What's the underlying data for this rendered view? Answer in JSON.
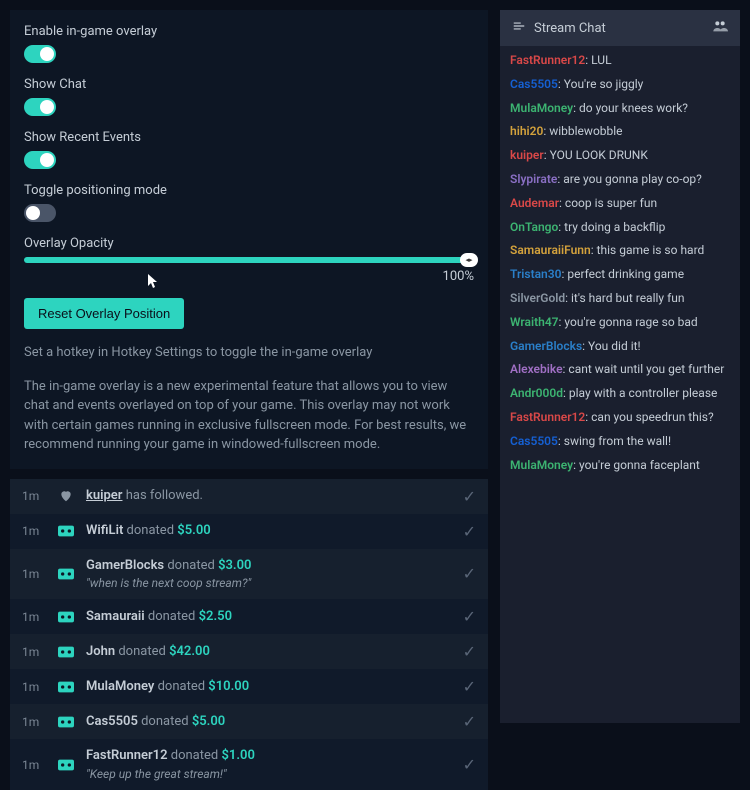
{
  "settings": {
    "enable_overlay": {
      "label": "Enable in-game overlay",
      "value": true
    },
    "show_chat": {
      "label": "Show Chat",
      "value": true
    },
    "show_events": {
      "label": "Show Recent Events",
      "value": true
    },
    "toggle_positioning": {
      "label": "Toggle positioning mode",
      "value": false
    },
    "opacity": {
      "label": "Overlay Opacity",
      "value": "100%"
    },
    "reset_label": "Reset Overlay Position",
    "hint": "Set a hotkey in Hotkey Settings to toggle the in-game overlay",
    "description": "The in-game overlay is a new experimental feature that allows you to view chat and events overlayed on top of your game. This overlay may not work with certain games running in exclusive fullscreen mode. For best results, we recommend running your game in windowed-fullscreen mode."
  },
  "events": [
    {
      "time": "1m",
      "type": "follow",
      "user": "kuiper",
      "action": "has followed."
    },
    {
      "time": "1m",
      "type": "donate",
      "user": "WifiLit",
      "action": "donated",
      "amount": "$5.00"
    },
    {
      "time": "1m",
      "type": "donate",
      "user": "GamerBlocks",
      "action": "donated",
      "amount": "$3.00",
      "message": "\"when is the next coop stream?\""
    },
    {
      "time": "1m",
      "type": "donate",
      "user": "Samauraii",
      "action": "donated",
      "amount": "$2.50"
    },
    {
      "time": "1m",
      "type": "donate",
      "user": "John",
      "action": "donated",
      "amount": "$42.00"
    },
    {
      "time": "1m",
      "type": "donate",
      "user": "MulaMoney",
      "action": "donated",
      "amount": "$10.00"
    },
    {
      "time": "1m",
      "type": "donate",
      "user": "Cas5505",
      "action": "donated",
      "amount": "$5.00"
    },
    {
      "time": "1m",
      "type": "donate",
      "user": "FastRunner12",
      "action": "donated",
      "amount": "$1.00",
      "message": "\"Keep up the great stream!\""
    }
  ],
  "chat": {
    "header": "Stream Chat",
    "messages": [
      {
        "user": "FastRunner12",
        "color": "#d94848",
        "text": "LUL"
      },
      {
        "user": "Cas5505",
        "color": "#1560d4",
        "text": "You're so jiggly"
      },
      {
        "user": "MulaMoney",
        "color": "#3cb371",
        "text": "do your knees work?"
      },
      {
        "user": "hihi20",
        "color": "#d4a23c",
        "text": "wibblewobble"
      },
      {
        "user": "kuiper",
        "color": "#d94848",
        "text": "YOU LOOK DRUNK"
      },
      {
        "user": "Slypirate",
        "color": "#8a6fc4",
        "text": "are you gonna play co-op?"
      },
      {
        "user": "Audemar",
        "color": "#d94848",
        "text": "coop is super fun"
      },
      {
        "user": "OnTango",
        "color": "#3cb371",
        "text": "try doing a backflip"
      },
      {
        "user": "SamauraiiFunn",
        "color": "#d4a23c",
        "text": "this game is so hard"
      },
      {
        "user": "Tristan30",
        "color": "#2a7fc9",
        "text": "perfect drinking game"
      },
      {
        "user": "SilverGold",
        "color": "#8a96a3",
        "text": "it's hard but really fun"
      },
      {
        "user": "Wraith47",
        "color": "#3cb371",
        "text": "you're gonna rage so bad"
      },
      {
        "user": "GamerBlocks",
        "color": "#2a7fc9",
        "text": "You did it!"
      },
      {
        "user": "Alexebike",
        "color": "#a06fc4",
        "text": "cant wait until you get further"
      },
      {
        "user": "Andr000d",
        "color": "#3cb371",
        "text": "play with a controller please"
      },
      {
        "user": "FastRunner12",
        "color": "#d94848",
        "text": "can you speedrun this?"
      },
      {
        "user": "Cas5505",
        "color": "#1560d4",
        "text": "swing from the wall!"
      },
      {
        "user": "MulaMoney",
        "color": "#3cb371",
        "text": "you're gonna faceplant"
      }
    ]
  }
}
